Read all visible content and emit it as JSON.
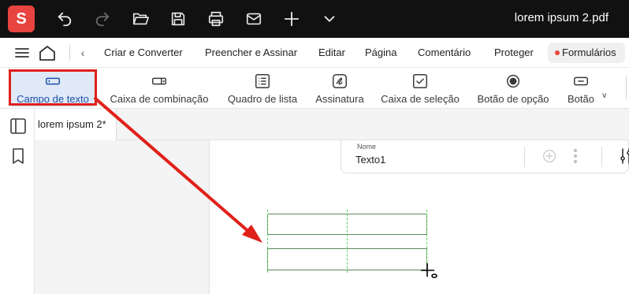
{
  "titlebar": {
    "app_logo": "S",
    "document_title": "lorem ipsum 2.pdf",
    "buttons": [
      "undo-icon",
      "redo-icon",
      "folder-open-icon",
      "save-icon",
      "print-icon",
      "mail-icon",
      "plus-icon",
      "chevron-down-icon"
    ]
  },
  "menubar": {
    "items": [
      "Criar e Converter",
      "Preencher e Assinar",
      "Editar",
      "Página",
      "Comentário",
      "Proteger"
    ],
    "active": "Formulários"
  },
  "toolbar": {
    "tools": [
      {
        "label": "Campo de texto",
        "icon": "text-field-icon",
        "active": true
      },
      {
        "label": "Caixa de combinação",
        "icon": "combo-box-icon",
        "active": false
      },
      {
        "label": "Quadro de lista",
        "icon": "list-box-icon",
        "active": false
      },
      {
        "label": "Assinatura",
        "icon": "signature-icon",
        "active": false
      },
      {
        "label": "Caixa de seleção",
        "icon": "checkbox-icon",
        "active": false
      },
      {
        "label": "Botão de opção",
        "icon": "radio-button-icon",
        "active": false
      },
      {
        "label": "Botão",
        "icon": "button-icon",
        "active": false
      }
    ]
  },
  "document_tab": {
    "label": "lorem ipsum 2*"
  },
  "field_properties": {
    "name_label": "Nome",
    "name_value": "Texto1"
  },
  "colors": {
    "accent": "#1d4fa5",
    "highlight": "#e0201a",
    "brand": "#e8443f",
    "guide": "#58d058"
  }
}
